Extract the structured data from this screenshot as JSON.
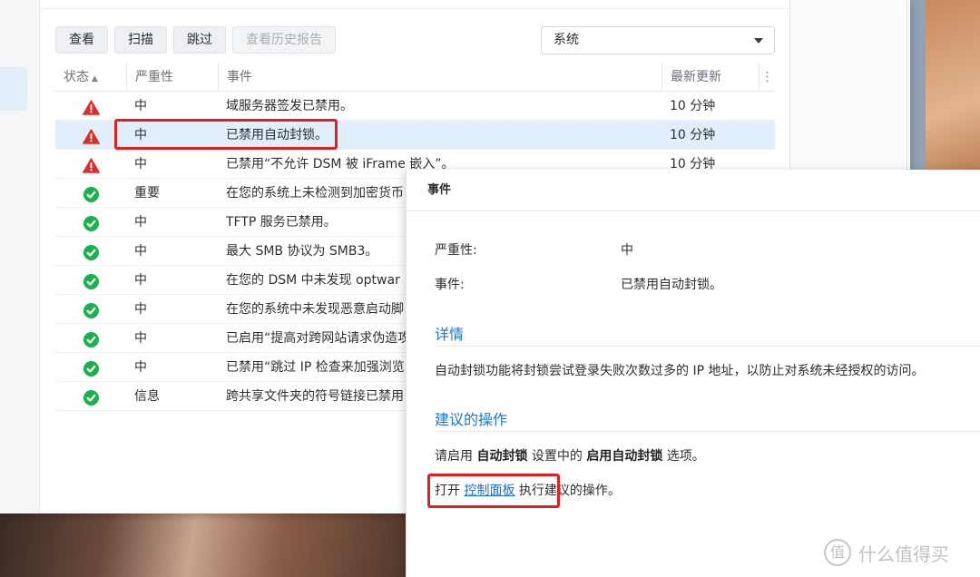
{
  "toolbar": {
    "view": "查看",
    "scan": "扫描",
    "skip": "跳过",
    "history": "查看历史报告"
  },
  "filter": {
    "selected": "系统"
  },
  "table": {
    "headers": {
      "status": "状态",
      "severity": "严重性",
      "event": "事件",
      "updated": "最新更新"
    },
    "rows": [
      {
        "status": "warning",
        "severity": "中",
        "event": "域服务器签发已禁用。",
        "time": "10 分钟"
      },
      {
        "status": "warning",
        "severity": "中",
        "event": "已禁用自动封锁。",
        "time": "10 分钟"
      },
      {
        "status": "warning",
        "severity": "中",
        "event": "已禁用“不允许 DSM 被 iFrame 嵌入”。",
        "time": "10 分钟"
      },
      {
        "status": "ok",
        "severity": "重要",
        "event": "在您的系统上未检测到加密货币",
        "time": ""
      },
      {
        "status": "ok",
        "severity": "中",
        "event": "TFTP 服务已禁用。",
        "time": ""
      },
      {
        "status": "ok",
        "severity": "中",
        "event": "最大 SMB 协议为 SMB3。",
        "time": ""
      },
      {
        "status": "ok",
        "severity": "中",
        "event": "在您的 DSM 中未发现 optwar",
        "time": ""
      },
      {
        "status": "ok",
        "severity": "中",
        "event": "在您的系统中未发现恶意启动脚",
        "time": ""
      },
      {
        "status": "ok",
        "severity": "中",
        "event": "已启用“提高对跨网站请求伪造攻",
        "time": ""
      },
      {
        "status": "ok",
        "severity": "中",
        "event": "已禁用“跳过 IP 检查来加强浏览",
        "time": ""
      },
      {
        "status": "ok",
        "severity": "信息",
        "event": "跨共享文件夹的符号链接已禁用",
        "time": ""
      }
    ]
  },
  "dialog": {
    "title": "事件",
    "severity_label": "严重性:",
    "severity_value": "中",
    "event_label": "事件:",
    "event_value": "已禁用自动封锁。",
    "details_heading": "详情",
    "details_text": "自动封锁功能将封锁尝试登录失败次数过多的 IP 地址，以防止对系统未经授权的访问。",
    "action_heading": "建议的操作",
    "action_p1_a": "请启用 ",
    "action_p1_b": "自动封锁",
    "action_p1_c": " 设置中的 ",
    "action_p1_d": "启用自动封锁",
    "action_p1_e": " 选项。",
    "action_p2_a": "打开 ",
    "action_p2_link": "控制面板",
    "action_p2_b": " 执行建议的操作。"
  },
  "watermark": {
    "icon": "值",
    "text": "什么值得买"
  },
  "colors": {
    "warn": "#d9302c",
    "ok": "#1db14e",
    "link": "#1a6fcf",
    "highlight": "#e02020",
    "selected_row": "#e1eefb"
  }
}
